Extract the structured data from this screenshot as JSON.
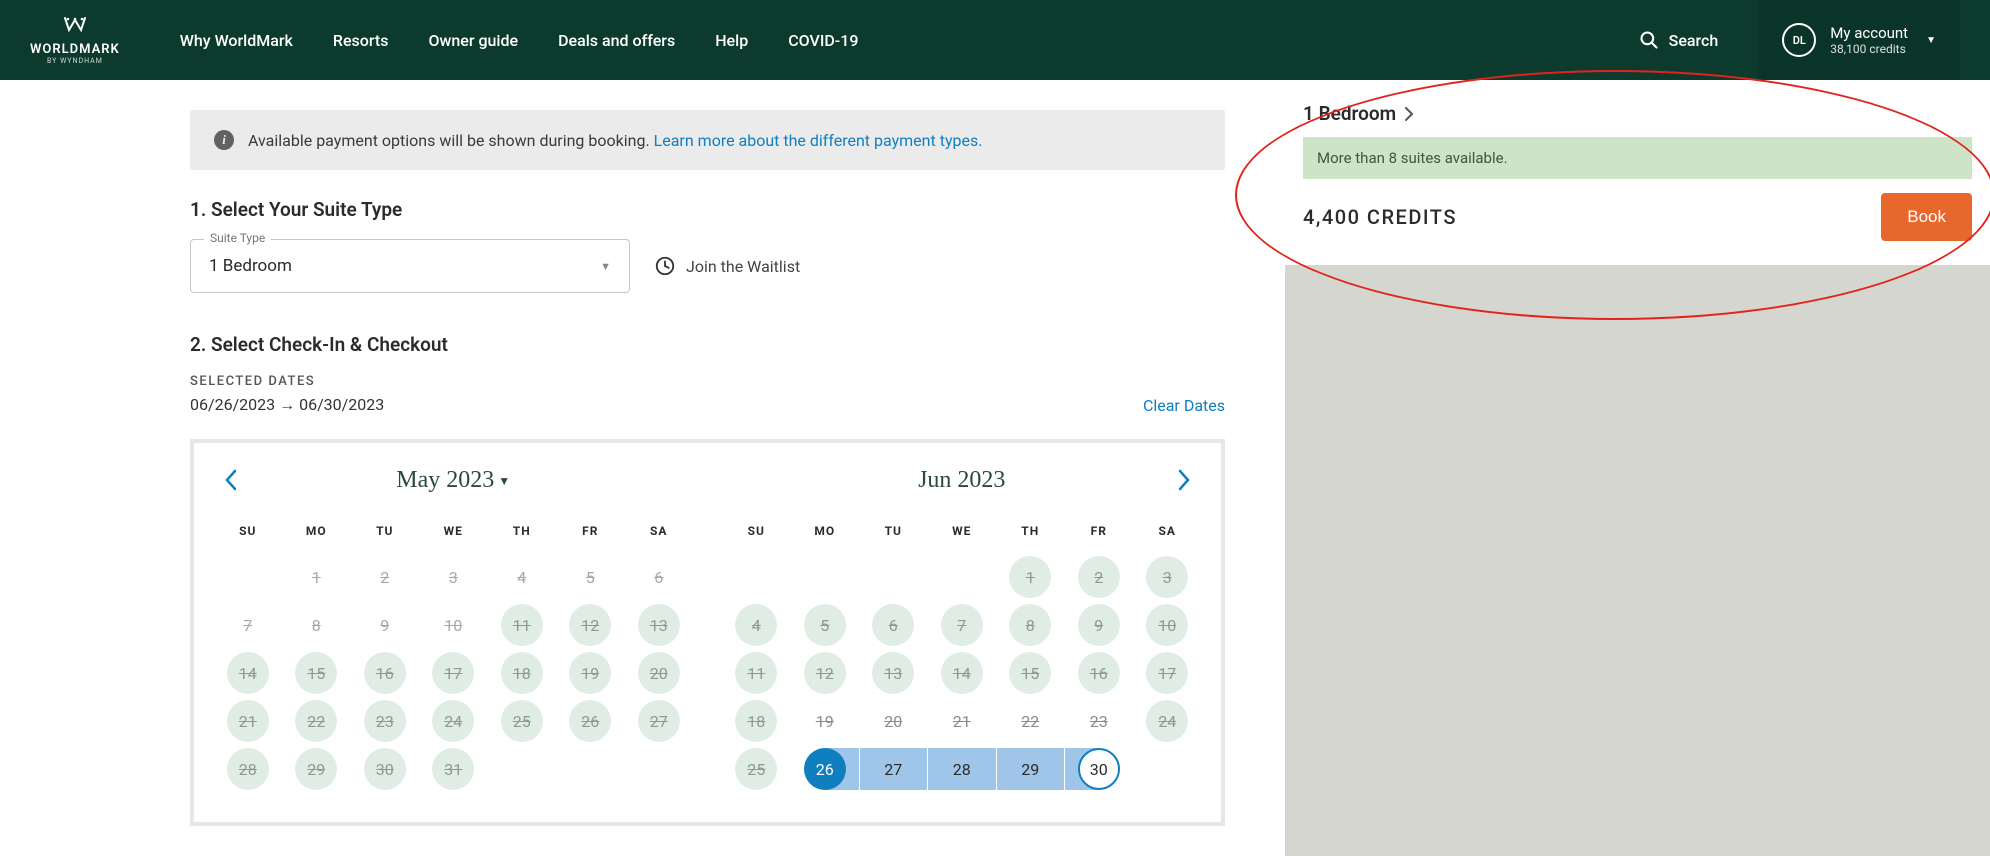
{
  "header": {
    "logo": {
      "text": "WORLDMARK",
      "sub": "BY WYNDHAM"
    },
    "nav": [
      "Why WorldMark",
      "Resorts",
      "Owner guide",
      "Deals and offers",
      "Help",
      "COVID-19"
    ],
    "search_label": "Search",
    "account": {
      "initials": "DL",
      "label": "My account",
      "credits": "38,100 credits"
    }
  },
  "info_banner": {
    "text": "Available payment options will be shown during booking. ",
    "link": "Learn more about the different payment types."
  },
  "sections": {
    "suite_heading": "1. Select Your Suite Type",
    "suite_label": "Suite Type",
    "suite_value": "1 Bedroom",
    "waitlist": "Join the Waitlist",
    "dates_heading": "2. Select Check-In & Checkout",
    "selected_label": "SELECTED DATES",
    "date_range": "06/26/2023 → 06/30/2023",
    "clear": "Clear Dates"
  },
  "calendars": {
    "dow": [
      "SU",
      "MO",
      "TU",
      "WE",
      "TH",
      "FR",
      "SA"
    ],
    "left": {
      "title": "May 2023",
      "cells": [
        {
          "t": "empty"
        },
        {
          "n": "1",
          "t": "past"
        },
        {
          "n": "2",
          "t": "past"
        },
        {
          "n": "3",
          "t": "past"
        },
        {
          "n": "4",
          "t": "past"
        },
        {
          "n": "5",
          "t": "past"
        },
        {
          "n": "6",
          "t": "past"
        },
        {
          "n": "7",
          "t": "past"
        },
        {
          "n": "8",
          "t": "past"
        },
        {
          "n": "9",
          "t": "past"
        },
        {
          "n": "10",
          "t": "past"
        },
        {
          "n": "11",
          "t": "avail"
        },
        {
          "n": "12",
          "t": "avail"
        },
        {
          "n": "13",
          "t": "avail"
        },
        {
          "n": "14",
          "t": "avail"
        },
        {
          "n": "15",
          "t": "avail"
        },
        {
          "n": "16",
          "t": "avail"
        },
        {
          "n": "17",
          "t": "avail"
        },
        {
          "n": "18",
          "t": "avail"
        },
        {
          "n": "19",
          "t": "avail"
        },
        {
          "n": "20",
          "t": "avail"
        },
        {
          "n": "21",
          "t": "avail"
        },
        {
          "n": "22",
          "t": "avail"
        },
        {
          "n": "23",
          "t": "avail"
        },
        {
          "n": "24",
          "t": "avail"
        },
        {
          "n": "25",
          "t": "avail"
        },
        {
          "n": "26",
          "t": "avail"
        },
        {
          "n": "27",
          "t": "avail"
        },
        {
          "n": "28",
          "t": "avail"
        },
        {
          "n": "29",
          "t": "avail"
        },
        {
          "n": "30",
          "t": "avail"
        },
        {
          "n": "31",
          "t": "avail"
        },
        {
          "t": "empty"
        },
        {
          "t": "empty"
        },
        {
          "t": "empty"
        }
      ]
    },
    "right": {
      "title": "Jun 2023",
      "cells": [
        {
          "t": "empty"
        },
        {
          "t": "empty"
        },
        {
          "t": "empty"
        },
        {
          "t": "empty"
        },
        {
          "n": "1",
          "t": "avail"
        },
        {
          "n": "2",
          "t": "avail"
        },
        {
          "n": "3",
          "t": "avail"
        },
        {
          "n": "4",
          "t": "avail"
        },
        {
          "n": "5",
          "t": "avail"
        },
        {
          "n": "6",
          "t": "avail"
        },
        {
          "n": "7",
          "t": "avail"
        },
        {
          "n": "8",
          "t": "avail"
        },
        {
          "n": "9",
          "t": "avail"
        },
        {
          "n": "10",
          "t": "avail"
        },
        {
          "n": "11",
          "t": "avail"
        },
        {
          "n": "12",
          "t": "avail"
        },
        {
          "n": "13",
          "t": "avail"
        },
        {
          "n": "14",
          "t": "avail"
        },
        {
          "n": "15",
          "t": "avail"
        },
        {
          "n": "16",
          "t": "avail"
        },
        {
          "n": "17",
          "t": "avail"
        },
        {
          "n": "18",
          "t": "avail"
        },
        {
          "n": "19",
          "t": "plain"
        },
        {
          "n": "20",
          "t": "plain"
        },
        {
          "n": "21",
          "t": "plain"
        },
        {
          "n": "22",
          "t": "plain"
        },
        {
          "n": "23",
          "t": "plain"
        },
        {
          "n": "24",
          "t": "avail"
        },
        {
          "n": "25",
          "t": "avail"
        },
        {
          "n": "26",
          "t": "sel-start"
        },
        {
          "n": "27",
          "t": "sel-mid"
        },
        {
          "n": "28",
          "t": "sel-mid"
        },
        {
          "n": "29",
          "t": "sel-mid"
        },
        {
          "n": "30",
          "t": "sel-end"
        },
        {
          "t": "empty"
        }
      ]
    }
  },
  "card": {
    "title": "1 Bedroom",
    "availability": "More than 8 suites available.",
    "credits": "4,400 CREDITS",
    "book": "Book"
  }
}
